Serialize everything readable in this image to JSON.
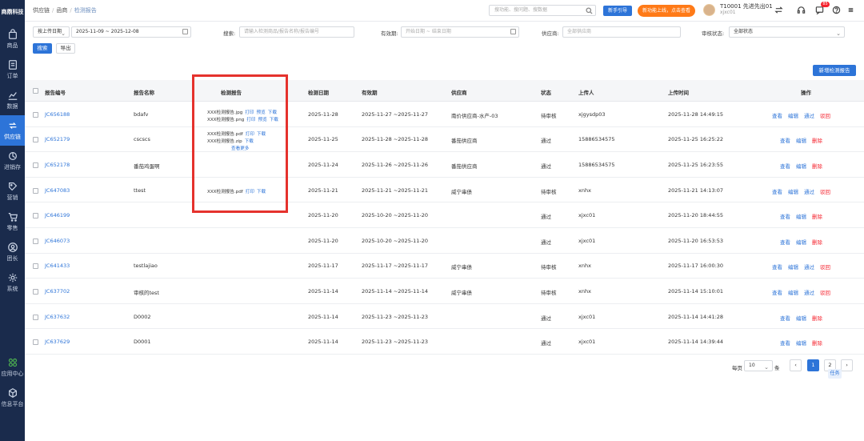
{
  "brand": "商鼎科技",
  "sidebar": {
    "items": [
      {
        "label": "商品",
        "icon": "bag-icon"
      },
      {
        "label": "订单",
        "icon": "order-icon"
      },
      {
        "label": "数据",
        "icon": "chart-icon"
      },
      {
        "label": "供应链",
        "icon": "supply-chain-icon"
      },
      {
        "label": "进销存",
        "icon": "inventory-icon"
      },
      {
        "label": "营销",
        "icon": "tag-icon"
      },
      {
        "label": "零售",
        "icon": "cart-icon"
      },
      {
        "label": "团长",
        "icon": "user-icon"
      },
      {
        "label": "系统",
        "icon": "gear-icon"
      }
    ],
    "bottom": [
      {
        "label": "应用中心",
        "icon": "apps-icon"
      },
      {
        "label": "信息平台",
        "icon": "cube-icon"
      }
    ]
  },
  "topbar": {
    "breadcrumb": [
      "供应链",
      "函商",
      "检测报告"
    ],
    "search_placeholder": "搜功能、搜问题、搜数据",
    "guide_btn": "新手引导",
    "promo_btn": "新功能上线，点击查看",
    "user_name": "T10001 先进先出01",
    "user_sub": "xjxc01",
    "badge_count": "85"
  },
  "filters": {
    "date_type": "按上传日期",
    "date_range": "2025-11-09 ~ 2025-12-08",
    "search_label": "搜索:",
    "search_placeholder": "请输入检测商品/报告名称/报告编号",
    "validity_label": "有效期:",
    "validity_placeholder": "开始日期 ~ 结束日期",
    "supplier_label": "供应商:",
    "supplier_placeholder": "全部供应商",
    "status_label": "审核状态:",
    "status_value": "全部状态",
    "search_btn": "搜索",
    "export_btn": "导出",
    "new_btn": "新增检测报告"
  },
  "table": {
    "headers": [
      "报告编号",
      "报告名称",
      "检测报告",
      "检测日期",
      "有效期",
      "供应商",
      "状态",
      "上传人",
      "上传时间",
      "操作"
    ],
    "rows": [
      {
        "id": "JC656188",
        "name": "bdafv",
        "date": "2025-11-28",
        "validity": "2025-11-27 ~2025-11-27",
        "supplier": "南价供应商-水产-03",
        "status": "待审核",
        "uploader": "xjgysdp03",
        "time": "2025-11-28 14:49:15",
        "reports": [
          {
            "file": "XXX检测报告.jpg",
            "links": [
              "打印",
              "预览",
              "下载"
            ]
          },
          {
            "file": "XXX检测报告.png",
            "links": [
              "打印",
              "预览",
              "下载"
            ]
          }
        ],
        "actions": [
          "查看",
          "编辑",
          "通过",
          "驳回"
        ]
      },
      {
        "id": "JC652179",
        "name": "cscscs",
        "date": "2025-11-25",
        "validity": "2025-11-28 ~2025-11-28",
        "supplier": "番茄供应商",
        "status": "通过",
        "uploader": "15886534575",
        "time": "2025-11-25 16:25:22",
        "reports": [
          {
            "file": "XXX检测报告.pdf",
            "links": [
              "打印",
              "下载"
            ]
          },
          {
            "file": "XXX检测报告.zip",
            "links": [
              "下载"
            ]
          }
        ],
        "more": "查看更多",
        "actions": [
          "查看",
          "编辑",
          "删除"
        ]
      },
      {
        "id": "JC652178",
        "name": "番茄鸡蛋啊",
        "date": "2025-11-24",
        "validity": "2025-11-26 ~2025-11-26",
        "supplier": "番茄供应商",
        "status": "通过",
        "uploader": "15886534575",
        "time": "2025-11-25 16:23:55",
        "reports": [],
        "actions": [
          "查看",
          "编辑",
          "删除"
        ]
      },
      {
        "id": "JC647083",
        "name": "ttest",
        "date": "2025-11-21",
        "validity": "2025-11-21 ~2025-11-21",
        "supplier": "威宁串债",
        "status": "待审核",
        "uploader": "xnhx",
        "time": "2025-11-21 14:13:07",
        "reports": [
          {
            "file": "XXX检测报告.pdf",
            "links": [
              "打印",
              "下载"
            ]
          }
        ],
        "actions": [
          "查看",
          "编辑",
          "通过",
          "驳回"
        ]
      },
      {
        "id": "JC646199",
        "name": "",
        "date": "2025-11-20",
        "validity": "2025-10-20 ~2025-11-20",
        "supplier": "",
        "status": "通过",
        "uploader": "xjxc01",
        "time": "2025-11-20 18:44:55",
        "reports": [],
        "actions": [
          "查看",
          "编辑",
          "删除"
        ]
      },
      {
        "id": "JC646073",
        "name": "",
        "date": "2025-11-20",
        "validity": "2025-10-20 ~2025-11-20",
        "supplier": "",
        "status": "通过",
        "uploader": "xjxc01",
        "time": "2025-11-20 16:53:53",
        "reports": [],
        "actions": [
          "查看",
          "编辑",
          "删除"
        ]
      },
      {
        "id": "JC641433",
        "name": "testlajiao",
        "date": "2025-11-17",
        "validity": "2025-11-17 ~2025-11-17",
        "supplier": "威宁串债",
        "status": "待审核",
        "uploader": "xnhx",
        "time": "2025-11-17 16:00:30",
        "reports": [],
        "actions": [
          "查看",
          "编辑",
          "通过",
          "驳回"
        ]
      },
      {
        "id": "JC637702",
        "name": "审核的test",
        "date": "2025-11-14",
        "validity": "2025-11-14 ~2025-11-14",
        "supplier": "威宁串债",
        "status": "待审核",
        "uploader": "xnhx",
        "time": "2025-11-14 15:10:01",
        "reports": [],
        "actions": [
          "查看",
          "编辑",
          "通过",
          "驳回"
        ]
      },
      {
        "id": "JC637632",
        "name": "D0002",
        "date": "2025-11-14",
        "validity": "2025-11-23 ~2025-11-23",
        "supplier": "",
        "status": "通过",
        "uploader": "xjxc01",
        "time": "2025-11-14 14:41:28",
        "reports": [],
        "actions": [
          "查看",
          "编辑",
          "删除"
        ]
      },
      {
        "id": "JC637629",
        "name": "D0001",
        "date": "2025-11-14",
        "validity": "2025-11-23 ~2025-11-23",
        "supplier": "",
        "status": "通过",
        "uploader": "xjxc01",
        "time": "2025-11-14 14:39:44",
        "reports": [],
        "actions": [
          "查看",
          "编辑",
          "删除"
        ]
      }
    ]
  },
  "pagination": {
    "per_page_label": "每页",
    "per_page": "10",
    "unit": "条",
    "pages": [
      "1",
      "2"
    ],
    "current": "1"
  },
  "task_label": "任务",
  "colors": {
    "primary": "#2d74d8",
    "danger": "#f5222d",
    "sidebar": "#1a2b4c",
    "highlight": "#e5322d"
  }
}
